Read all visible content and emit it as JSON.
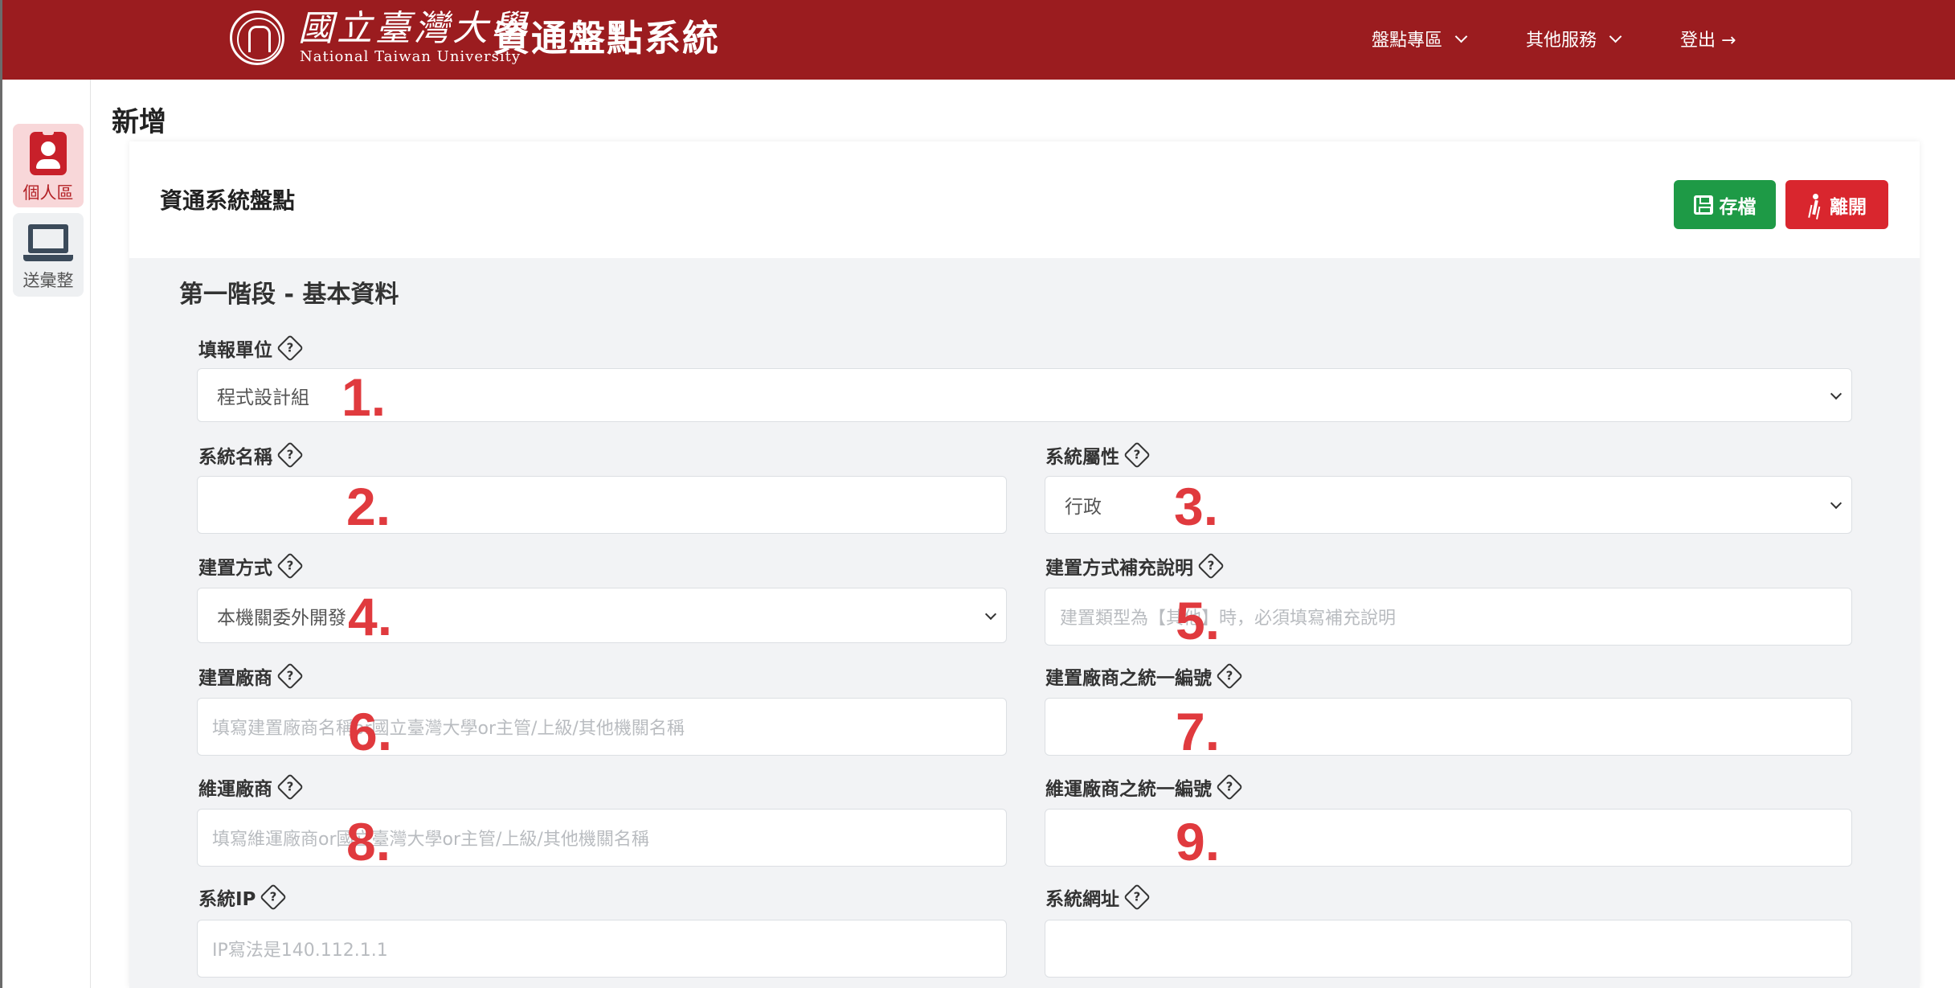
{
  "header": {
    "logo_cn": "國立臺灣大學",
    "logo_en": "National Taiwan University",
    "app_title": "資通盤點系統",
    "nav": [
      {
        "label": "盤點專區",
        "has_dropdown": true
      },
      {
        "label": "其他服務",
        "has_dropdown": true
      },
      {
        "label": "登出 →",
        "has_dropdown": false
      }
    ],
    "bg_color": "#9b1c1f"
  },
  "sidebar": {
    "items": [
      {
        "label": "個人區",
        "icon": "id-badge-icon",
        "active": true
      },
      {
        "label": "送彙整",
        "icon": "laptop-icon",
        "active": false
      }
    ]
  },
  "page": {
    "title": "新增"
  },
  "card": {
    "title": "資通系統盤點",
    "save_label": "存檔",
    "leave_label": "離開",
    "save_color": "#1e9a46",
    "leave_color": "#d9262e"
  },
  "form": {
    "section_title": "第一階段 - 基本資料",
    "fields": {
      "unit": {
        "label": "填報單位",
        "value": "程式設計組",
        "marker": "1."
      },
      "system_name": {
        "label": "系統名稱",
        "value": "",
        "marker": "2."
      },
      "system_attr": {
        "label": "系統屬性",
        "value": "行政",
        "marker": "3."
      },
      "build_method": {
        "label": "建置方式",
        "value": "本機關委外開發",
        "marker": "4."
      },
      "build_note": {
        "label": "建置方式補充說明",
        "placeholder": "建置類型為【其他】時，必須填寫補充說明",
        "marker": "5."
      },
      "build_vendor": {
        "label": "建置廠商",
        "placeholder": "填寫建置廠商名稱or國立臺灣大學or主管/上級/其他機關名稱",
        "marker": "6."
      },
      "build_vendor_id": {
        "label": "建置廠商之統一編號",
        "value": "",
        "marker": "7."
      },
      "maint_vendor": {
        "label": "維運廠商",
        "placeholder": "填寫維運廠商or國立臺灣大學or主管/上級/其他機關名稱",
        "marker": "8."
      },
      "maint_vendor_id": {
        "label": "維運廠商之統一編號",
        "value": "",
        "marker": "9."
      },
      "system_ip": {
        "label": "系統IP",
        "placeholder": "IP寫法是140.112.1.1"
      },
      "system_url": {
        "label": "系統網址",
        "value": ""
      }
    },
    "help_glyph": "?"
  }
}
